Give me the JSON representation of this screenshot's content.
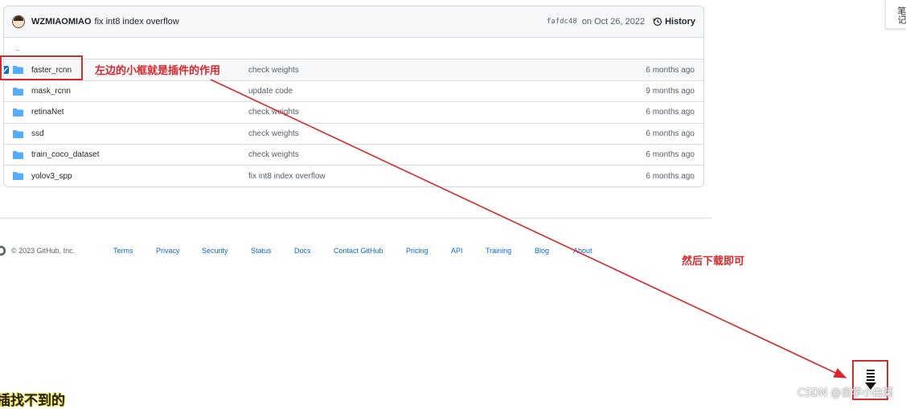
{
  "commit": {
    "author": "WZMIAOMIAO",
    "message": "fix int8 index overflow",
    "sha": "fafdc48",
    "date": "on Oct 26, 2022",
    "history_label": "History"
  },
  "up_dir": "..",
  "files": [
    {
      "name": "faster_rcnn",
      "message": "check weights",
      "age": "6 months ago",
      "checked": true
    },
    {
      "name": "mask_rcnn",
      "message": "update code",
      "age": "9 months ago"
    },
    {
      "name": "retinaNet",
      "message": "check weights",
      "age": "6 months ago"
    },
    {
      "name": "ssd",
      "message": "check weights",
      "age": "6 months ago"
    },
    {
      "name": "train_coco_dataset",
      "message": "check weights",
      "age": "6 months ago"
    },
    {
      "name": "yolov3_spp",
      "message": "fix int8 index overflow",
      "age": "6 months ago"
    }
  ],
  "footer": {
    "copyright": "© 2023 GitHub, Inc.",
    "links": [
      "Terms",
      "Privacy",
      "Security",
      "Status",
      "Docs",
      "Contact GitHub",
      "Pricing",
      "API",
      "Training",
      "Blog",
      "About"
    ]
  },
  "annotations": {
    "checkbox_note": "左边的小框就是插件的作用",
    "download_note": "然后下载即可"
  },
  "side_tab": "笔记",
  "bottom_caption": "插找不到的",
  "watermark": "CSDN @自学小白菜",
  "colors": {
    "annotation_red": "#e0252a",
    "folder_blue": "#54aeff",
    "link_blue": "#0969da"
  }
}
